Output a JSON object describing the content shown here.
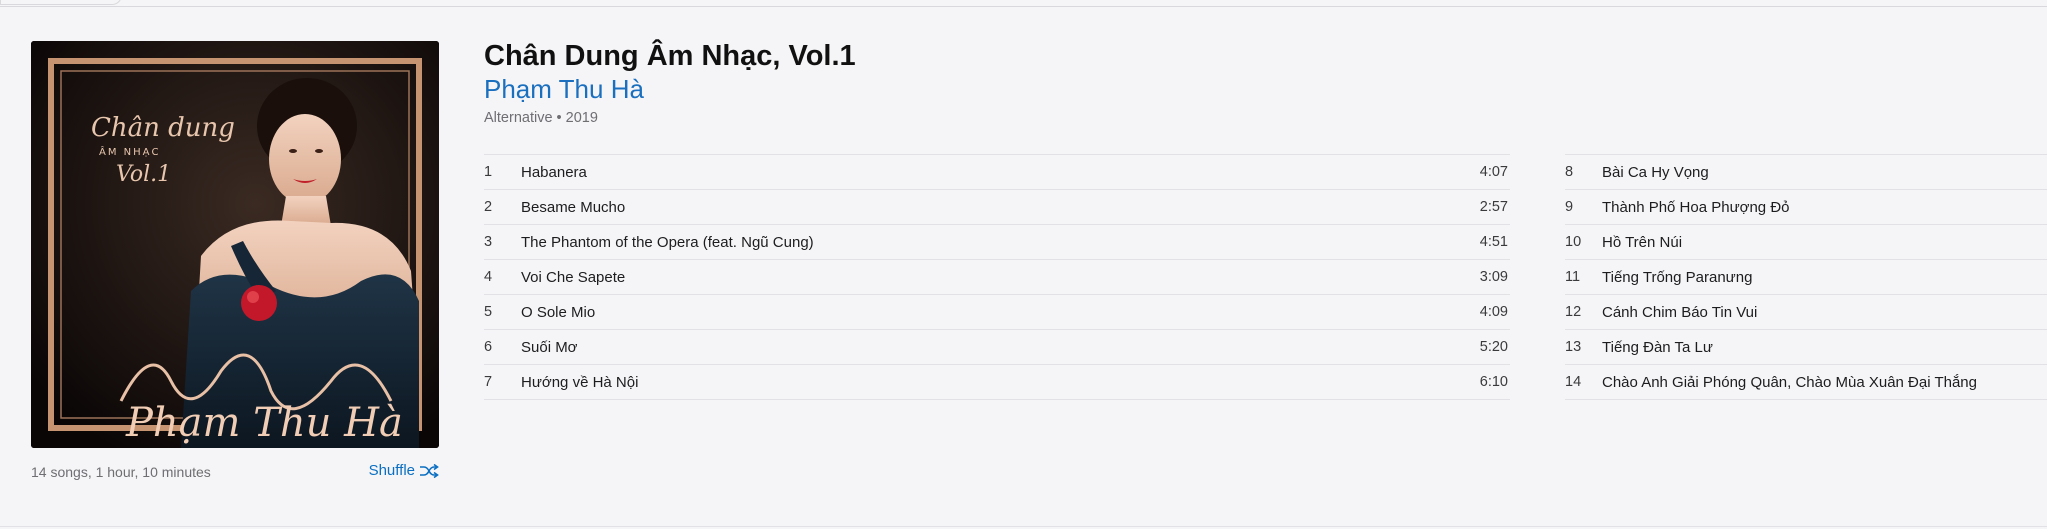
{
  "album": {
    "title": "Chân Dung Âm Nhạc, Vol.1",
    "artist": "Phạm Thu Hà",
    "info": "Alternative • 2019",
    "summary": "14 songs, 1 hour, 10 minutes",
    "shuffle_label": "Shuffle",
    "accent_color": "#0a6fc2"
  },
  "artwork": {
    "title_script": "Chân dung",
    "subtitle_caps": "ÂM NHẠC",
    "volume_script": "Vol.1",
    "signature": "Phạm Thu Hà"
  },
  "tracks_left": [
    {
      "num": "1",
      "name": "Habanera",
      "duration": "4:07"
    },
    {
      "num": "2",
      "name": "Besame Mucho",
      "duration": "2:57"
    },
    {
      "num": "3",
      "name": "The Phantom of the Opera (feat. Ngũ Cung)",
      "duration": "4:51"
    },
    {
      "num": "4",
      "name": "Voi Che Sapete",
      "duration": "3:09"
    },
    {
      "num": "5",
      "name": "O Sole Mio",
      "duration": "4:09"
    },
    {
      "num": "6",
      "name": "Suối Mơ",
      "duration": "5:20"
    },
    {
      "num": "7",
      "name": "Hướng về Hà Nội",
      "duration": "6:10"
    }
  ],
  "tracks_right": [
    {
      "num": "8",
      "name": "Bài Ca Hy Vọng"
    },
    {
      "num": "9",
      "name": "Thành Phố Hoa Phượng Đỏ"
    },
    {
      "num": "10",
      "name": "Hồ Trên Núi"
    },
    {
      "num": "11",
      "name": "Tiếng Trống Paranưng"
    },
    {
      "num": "12",
      "name": "Cánh Chim Báo Tin Vui"
    },
    {
      "num": "13",
      "name": "Tiếng Đàn Ta Lư"
    },
    {
      "num": "14",
      "name": "Chào Anh Giải Phóng Quân, Chào Mùa Xuân Đại Thắng"
    }
  ]
}
